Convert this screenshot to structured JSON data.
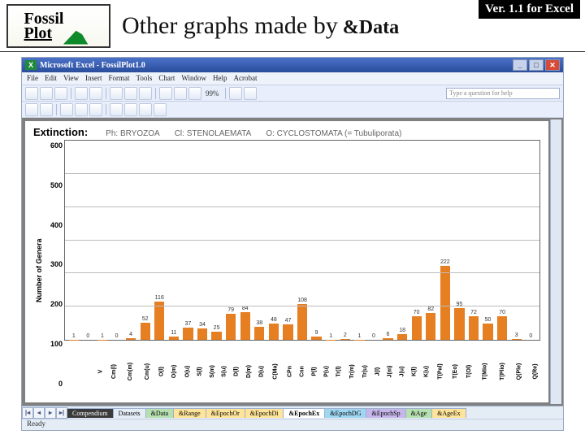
{
  "header": {
    "logo_line1": "Fossil",
    "logo_line2": "Plot",
    "title_prefix": "Other graphs made by",
    "brand": "&Data",
    "version": "Ver. 1.1 for Excel"
  },
  "excel": {
    "title": "Microsoft Excel - FossilPlot1.0",
    "menus": [
      "File",
      "Edit",
      "View",
      "Insert",
      "Format",
      "Tools",
      "Chart",
      "Window",
      "Help",
      "Acrobat"
    ],
    "helpbox": "Type a question for help",
    "zoom": "99%",
    "status": "Ready",
    "winbtns": {
      "min": "_",
      "max": "□",
      "close": "✕"
    }
  },
  "chart_header": {
    "prefix": "Extinction:",
    "items": [
      "Ph: BRYOZOA",
      "Cl: STENOLAEMATA",
      "O: CYCLOSTOMATA (= Tubuliporata)"
    ]
  },
  "chart_data": {
    "type": "bar",
    "title": "Extinction",
    "ylabel": "Number of Genera",
    "xlabel": "",
    "ylim": [
      0,
      600
    ],
    "yticks": [
      0,
      100,
      200,
      300,
      400,
      500,
      600
    ],
    "categories": [
      "V",
      "Cm(l)",
      "Cm(m)",
      "Cm(u)",
      "O(l)",
      "O(m)",
      "O(u)",
      "S(l)",
      "S(m)",
      "S(u)",
      "D(l)",
      "D(m)",
      "D(u)",
      "C(Ma)",
      "CPn",
      "Cnn",
      "P(l)",
      "P(u)",
      "Tr(l)",
      "Tr(m)",
      "Tr(u)",
      "J(l)",
      "J(m)",
      "J(u)",
      "K(l)",
      "K(u)",
      "T(Pal)",
      "T(Eo)",
      "T(Ol)",
      "T(Mio)",
      "T(Plio)",
      "Q(Ple)",
      "Q(Re)"
    ],
    "values": [
      1,
      0,
      1,
      0,
      4,
      52,
      116,
      11,
      37,
      34,
      25,
      79,
      84,
      38,
      48,
      47,
      108,
      9,
      1,
      2,
      1,
      0,
      6,
      18,
      70,
      82,
      222,
      95,
      72,
      50,
      70,
      3,
      0
    ]
  },
  "tabs": [
    "Compendium",
    "Datasets",
    "&Data",
    "&Range",
    "&EpochOr",
    "&EpochDi",
    "&EpochEx",
    "&EpochDG",
    "&EpochSp",
    "&Age",
    "&AgeEx"
  ]
}
